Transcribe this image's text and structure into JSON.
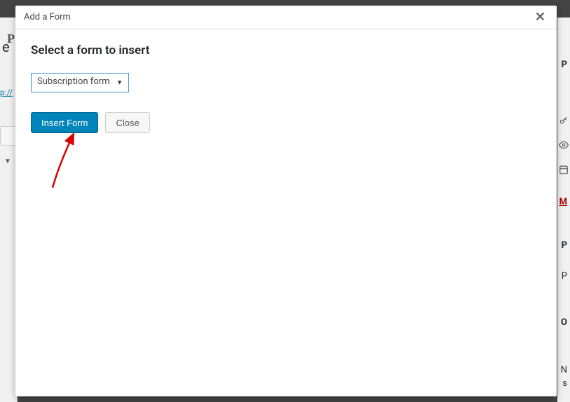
{
  "modal": {
    "title": "Add a Form",
    "heading": "Select a form to insert",
    "select": {
      "selected_label": "Subscription form"
    },
    "buttons": {
      "insert_label": "Insert Form",
      "close_label": "Close"
    }
  },
  "background": {
    "left_char": "P",
    "left_e": "e",
    "left_link": "p://",
    "chevron": "▼",
    "right_p1": "P",
    "right_m": "M",
    "right_p2": "P",
    "right_p3": "P",
    "right_o": "O",
    "right_n": "N",
    "right_s": "s"
  },
  "annotation": {
    "arrow_color": "#d60000"
  }
}
